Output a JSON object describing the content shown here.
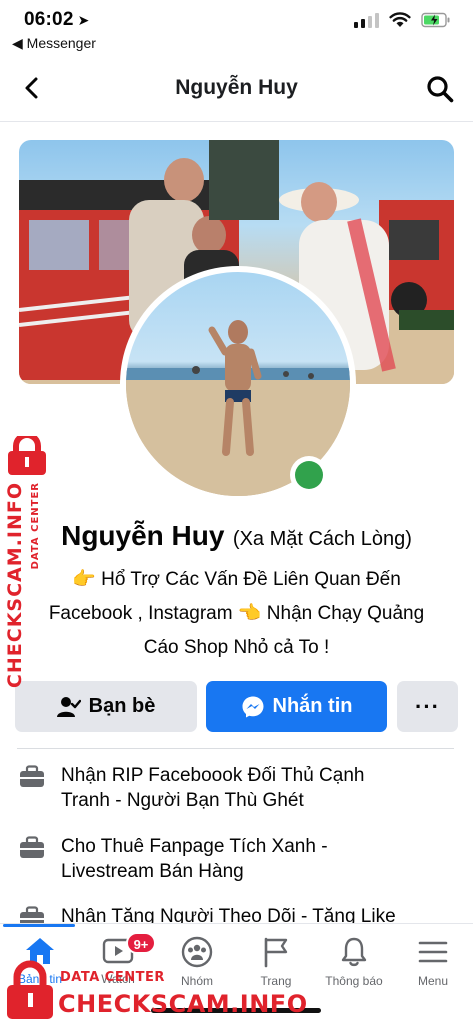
{
  "status_bar": {
    "time": "06:02",
    "back_app": "◀ Messenger"
  },
  "header": {
    "title": "Nguyễn Huy"
  },
  "profile": {
    "name": "Nguyễn Huy",
    "alternate_name": "(Xa Mặt Cách Lòng)",
    "bio_line1": "👉 Hổ Trợ Các Vấn Đề Liên Quan Đến",
    "bio_line2": "Facebook , Instagram  👈 Nhận Chạy Quảng",
    "bio_line3": "Cáo Shop Nhỏ cả To !",
    "online": true
  },
  "actions": {
    "friends_label": "Bạn bè",
    "message_label": "Nhắn tin",
    "more_label": "···"
  },
  "intro": [
    {
      "line1": "Nhận RIP Faceboook Đối Thủ Cạnh",
      "line2": "Tranh - Người Bạn Thù Ghét"
    },
    {
      "line1": "Cho Thuê Fanpage Tích Xanh -",
      "line2": "Livestream Bán Hàng"
    },
    {
      "line1": "Nhận Tăng Người Theo Dõi - Tăng Like",
      "line2": ""
    }
  ],
  "tabbar": {
    "tabs": [
      {
        "label": "Bảng tin",
        "icon": "home-icon",
        "active": true
      },
      {
        "label": "Watch",
        "icon": "watch-icon",
        "badge": "9+"
      },
      {
        "label": "Nhóm",
        "icon": "groups-icon"
      },
      {
        "label": "Trang",
        "icon": "flag-icon"
      },
      {
        "label": "Thông báo",
        "icon": "bell-icon"
      },
      {
        "label": "Menu",
        "icon": "menu-icon"
      }
    ]
  },
  "watermark": {
    "data_center": "DATA CENTER",
    "brand": "CHECKSCAM.INFO"
  },
  "colors": {
    "accent": "#1877f2",
    "online": "#31a24c",
    "badge": "#e41e3f",
    "watermark": "#e0232c"
  }
}
